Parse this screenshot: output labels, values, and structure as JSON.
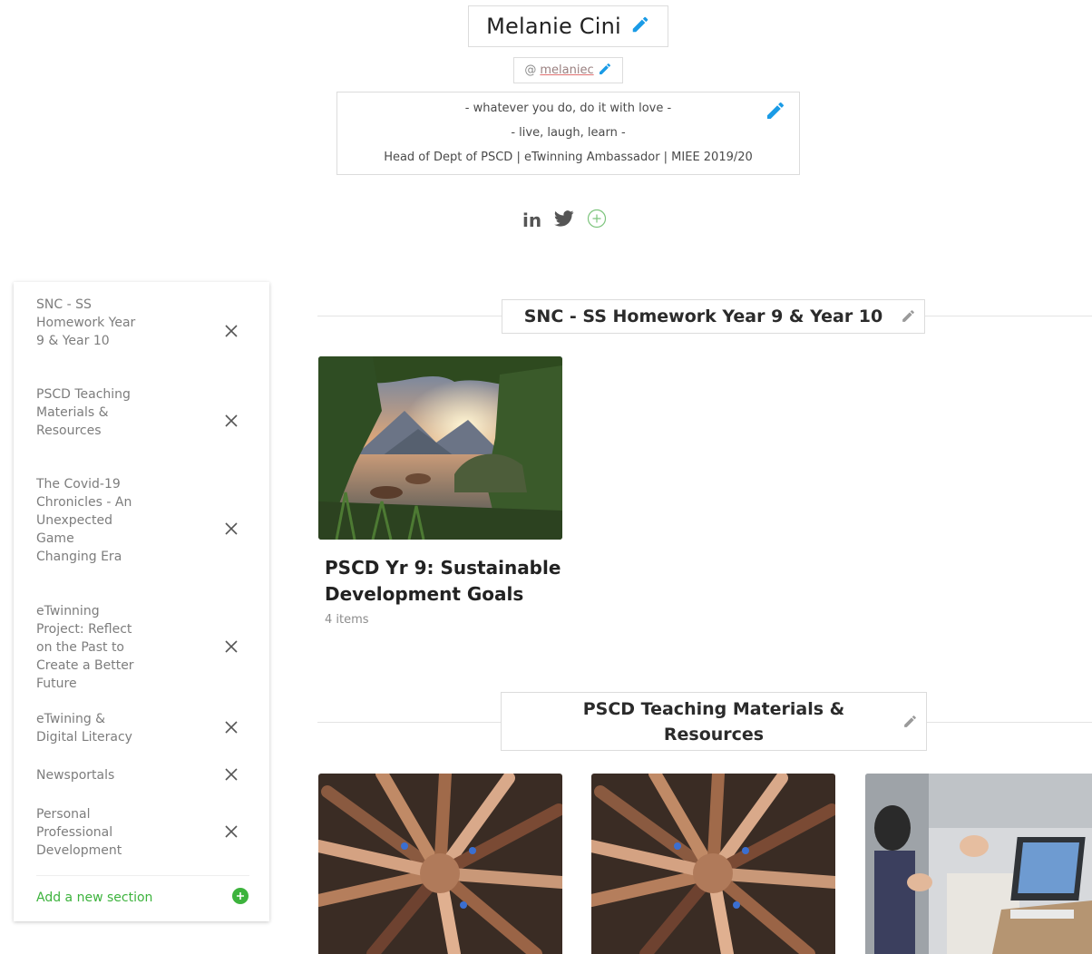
{
  "profile": {
    "name": "Melanie Cini",
    "handle_at": "@",
    "handle": "melaniec",
    "bio_lines": [
      "- whatever you do, do it with love -",
      "- live, laugh, learn -",
      "Head of Dept of PSCD | eTwinning Ambassador | MIEE 2019/20"
    ]
  },
  "social": {
    "linkedin_label": "in",
    "icons": [
      "linkedin-icon",
      "twitter-icon",
      "add-circle-icon"
    ]
  },
  "sidebar": {
    "items": [
      {
        "label": "SNC - SS Homework Year 9 & Year 10"
      },
      {
        "label": "PSCD Teaching Materials & Resources"
      },
      {
        "label": "The Covid-19 Chronicles - An Unexpected Game Changing Era"
      },
      {
        "label": "eTwinning Project: Reflect on the Past to Create a Better Future"
      },
      {
        "label": "eTwining & Digital Literacy"
      },
      {
        "label": "Newsportals"
      },
      {
        "label": "Personal Professional Development"
      }
    ],
    "add_label": "Add a new section"
  },
  "sections": [
    {
      "title": "SNC - SS Homework Year 9 & Year 10",
      "cards": [
        {
          "title": "PSCD Yr 9: Sustainable Development Goals",
          "count": "4 items"
        }
      ]
    },
    {
      "title": "PSCD Teaching Materials & Resources"
    }
  ],
  "colors": {
    "accent_blue": "#1a9be6",
    "accent_green": "#3db33d",
    "text_gray": "#7d7d7d"
  }
}
